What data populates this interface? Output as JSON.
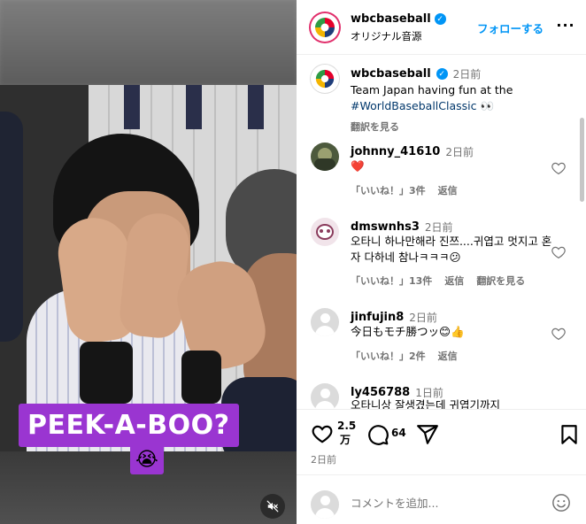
{
  "media": {
    "overlay_text": "PEEK-A-BOO?",
    "overlay_emoji": "😭",
    "mute_icon": "muted-speaker-icon",
    "overlay_color": "#9a35d1"
  },
  "header": {
    "username": "wbcbaseball",
    "subtitle": "オリジナル音源",
    "follow_label": "フォローする",
    "more_label": "···"
  },
  "caption": {
    "username": "wbcbaseball",
    "time": "2日前",
    "text_prefix": "Team Japan having fun at the",
    "hashtag": "#WorldBaseballClassic",
    "emoji": "👀",
    "translate_label": "翻訳を見る"
  },
  "comments": [
    {
      "username": "johnny_41610",
      "time": "2日前",
      "text": "❤️",
      "likes_label": "「いいね！」3件",
      "reply_label": "返信",
      "translate_label": ""
    },
    {
      "username": "dmswnhs3",
      "time": "2日前",
      "text": "오타니 하나만해라 진쯔....귀엽고 멋지고 혼자 다하네 참나ㅋㅋㅋ😕",
      "likes_label": "「いいね！」13件",
      "reply_label": "返信",
      "translate_label": "翻訳を見る"
    },
    {
      "username": "jinfujin8",
      "time": "2日前",
      "text": "今日もモチ勝つッ😊👍",
      "likes_label": "「いいね！」2件",
      "reply_label": "返信",
      "translate_label": ""
    },
    {
      "username": "ly456788",
      "time": "1日前",
      "text": "오타니상 잘생겼는데 귀엽기까지",
      "likes_label": "",
      "reply_label": "",
      "translate_label": ""
    }
  ],
  "actions": {
    "like_count": "2.5 万",
    "like_count_line1": "2.5",
    "like_count_line2": "万",
    "comment_count": "64",
    "post_time": "2日前"
  },
  "add_comment": {
    "placeholder": "コメントを追加...",
    "value": ""
  },
  "colors": {
    "accent": "#0095f6",
    "secondary_text": "#737373",
    "heart": "#ed4956"
  }
}
